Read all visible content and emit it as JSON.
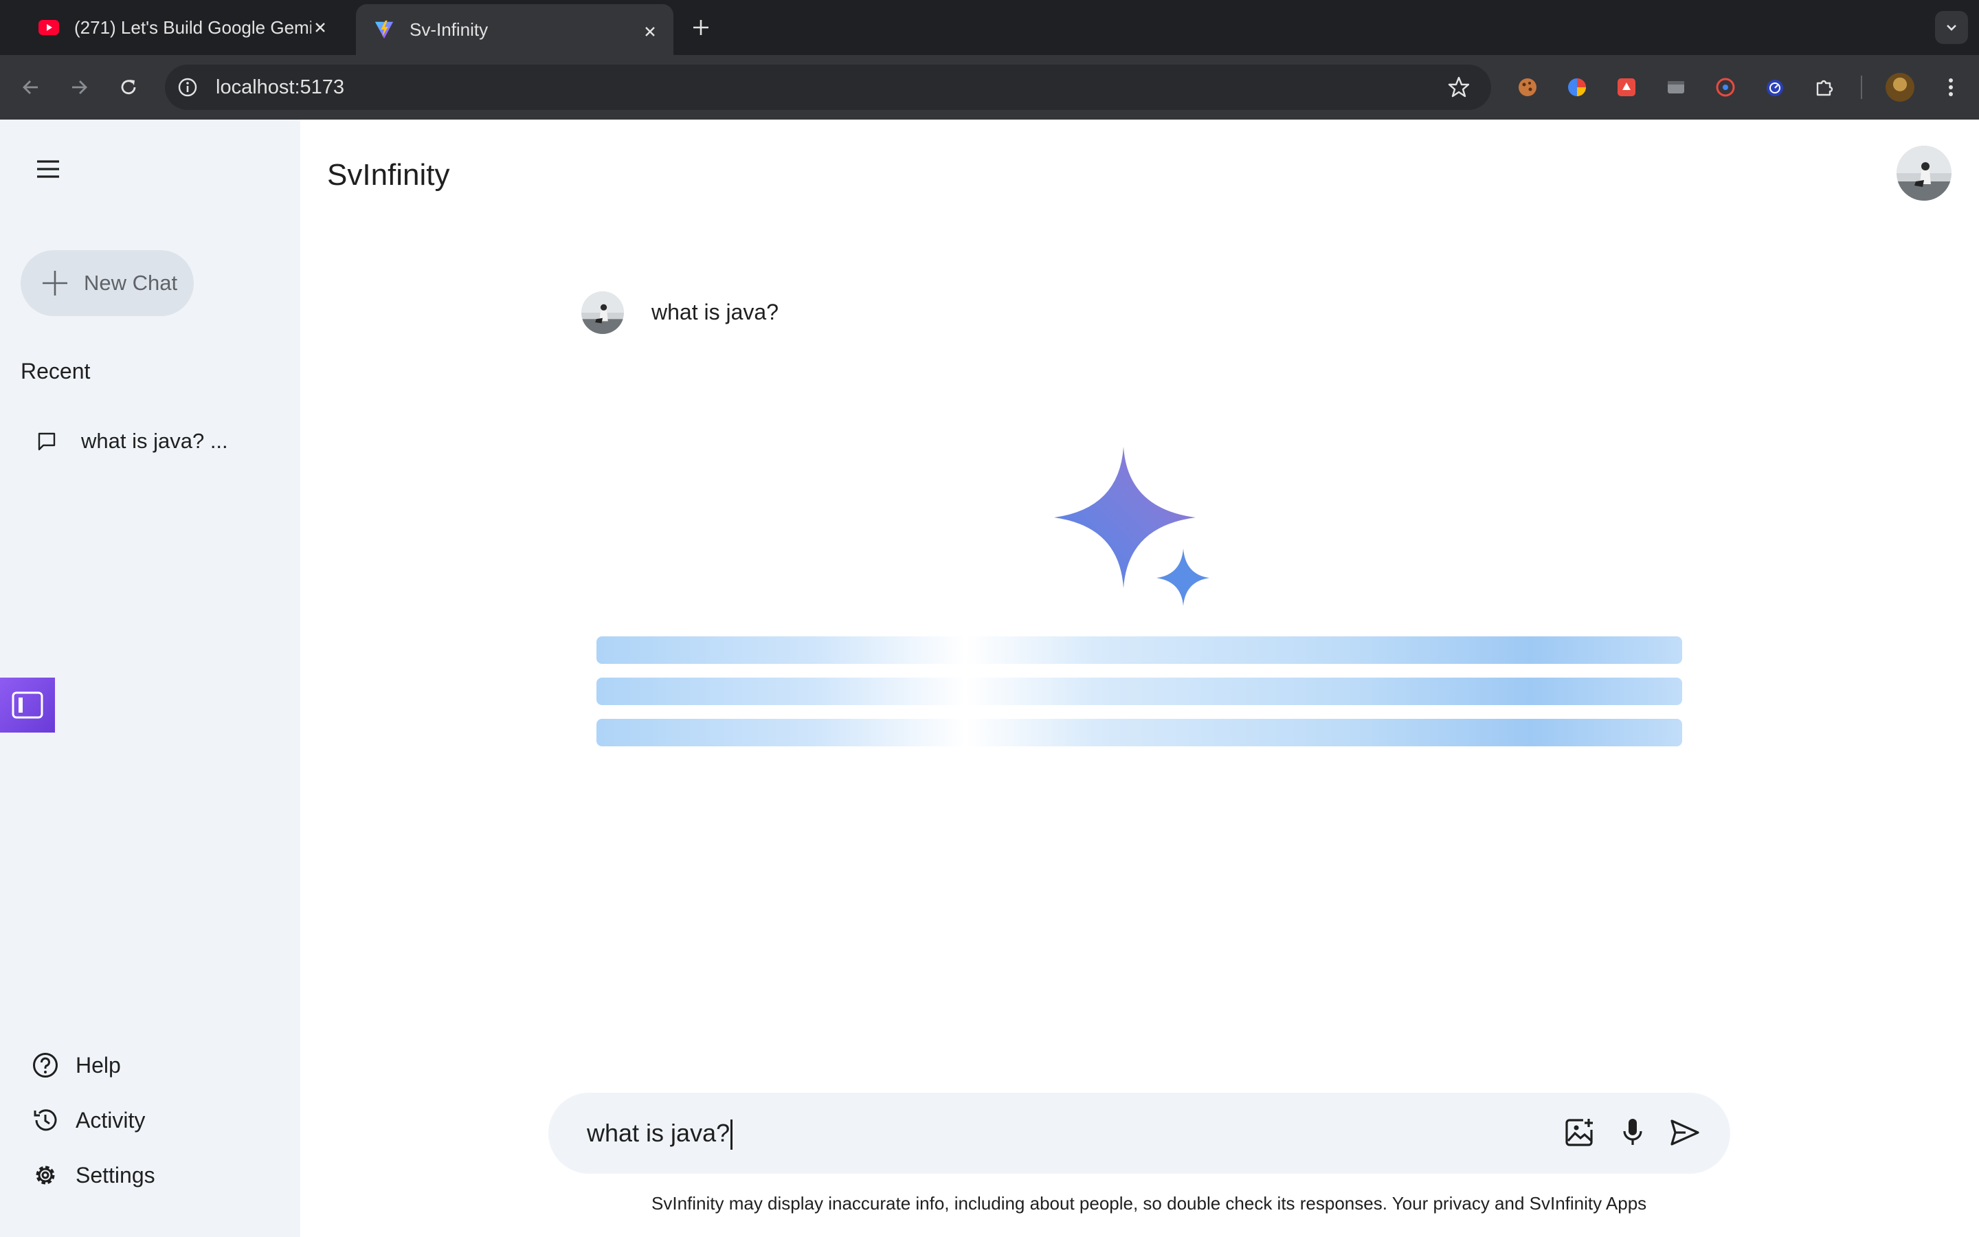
{
  "browser": {
    "tabs": [
      {
        "title": "(271) Let's Build Google Gemini Clone",
        "favicon": "youtube-icon",
        "active": false
      },
      {
        "title": "Sv-Infinity",
        "favicon": "vite-icon",
        "active": true
      }
    ],
    "url": "localhost:5173"
  },
  "sidebar": {
    "new_chat_label": "New Chat",
    "recent_title": "Recent",
    "recent_items": [
      {
        "label": "what is java? ..."
      }
    ],
    "bottom_items": [
      {
        "label": "Help",
        "icon": "help-icon"
      },
      {
        "label": "Activity",
        "icon": "history-icon"
      },
      {
        "label": "Settings",
        "icon": "settings-icon"
      }
    ]
  },
  "header": {
    "title": "SvInfinity"
  },
  "conversation": {
    "user_message": "what is java?",
    "loading_lines": 3
  },
  "input": {
    "value": "what is java?"
  },
  "footer": {
    "disclaimer": "SvInfinity may display inaccurate info, including about people, so double check its responses. Your privacy and SvInfinity Apps"
  },
  "colors": {
    "sidebar_bg": "#f0f4f9",
    "sparkle_start": "#4f86e8",
    "sparkle_end": "#9b72cb",
    "loader_blue": "#9ec9f4"
  }
}
